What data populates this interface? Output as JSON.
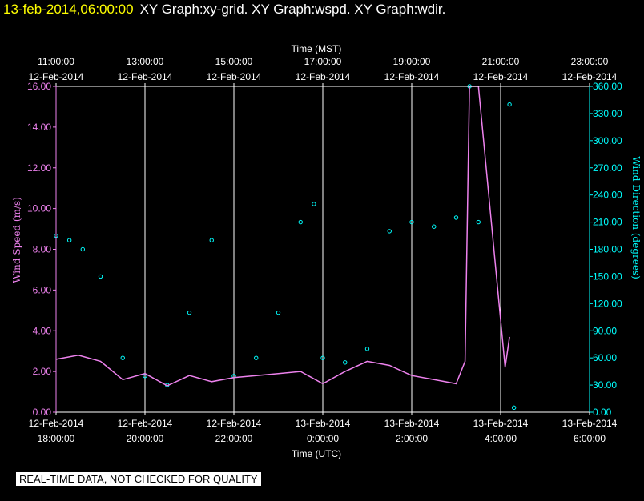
{
  "header": {
    "timestamp": "13-feb-2014,06:00:00",
    "title": "XY Graph:xy-grid.  XY Graph:wspd.  XY Graph:wdir."
  },
  "disclaimer": "REAL-TIME DATA, NOT CHECKED FOR QUALITY",
  "colors": {
    "background": "#000000",
    "axes": "#ffffff",
    "grid": "#ffffff",
    "wind_speed": "#ee82ee",
    "wind_direction": "#00ffff",
    "header_date": "#ffff00"
  },
  "chart_data": {
    "type": "scatter",
    "title": "",
    "grid": true,
    "top_axis": {
      "label": "Time (MST)",
      "ticks": [
        {
          "time": "11:00:00",
          "date": "12-Feb-2014"
        },
        {
          "time": "13:00:00",
          "date": "12-Feb-2014"
        },
        {
          "time": "15:00:00",
          "date": "12-Feb-2014"
        },
        {
          "time": "17:00:00",
          "date": "12-Feb-2014"
        },
        {
          "time": "19:00:00",
          "date": "12-Feb-2014"
        },
        {
          "time": "21:00:00",
          "date": "12-Feb-2014"
        },
        {
          "time": "23:00:00",
          "date": "12-Feb-2014"
        }
      ]
    },
    "bottom_axis": {
      "label": "Time (UTC)",
      "range_hours_utc": [
        "2014-02-12T18:00",
        "2014-02-13T06:00"
      ],
      "ticks": [
        {
          "date": "12-Feb-2014",
          "time": "18:00:00"
        },
        {
          "date": "12-Feb-2014",
          "time": "20:00:00"
        },
        {
          "date": "12-Feb-2014",
          "time": "22:00:00"
        },
        {
          "date": "13-Feb-2014",
          "time": "0:00:00"
        },
        {
          "date": "13-Feb-2014",
          "time": "2:00:00"
        },
        {
          "date": "13-Feb-2014",
          "time": "4:00:00"
        },
        {
          "date": "13-Feb-2014",
          "time": "6:00:00"
        }
      ]
    },
    "left_axis": {
      "label": "Wind Speed (m/s)",
      "ylim": [
        0,
        16
      ],
      "ticks": [
        "0.00",
        "2.00",
        "4.00",
        "6.00",
        "8.00",
        "10.00",
        "12.00",
        "14.00",
        "16.00"
      ]
    },
    "right_axis": {
      "label": "Wind Direction (degrees)",
      "ylim": [
        0,
        360
      ],
      "ticks": [
        "0.00",
        "30.00",
        "60.00",
        "90.00",
        "120.00",
        "150.00",
        "180.00",
        "210.00",
        "240.00",
        "270.00",
        "300.00",
        "330.00",
        "360.00"
      ]
    },
    "series": [
      {
        "name": "wspd",
        "style": "line",
        "axis": "left",
        "x_hours_utc": [
          18.0,
          18.5,
          19.0,
          19.5,
          20.0,
          20.5,
          21.0,
          21.5,
          22.0,
          22.5,
          23.0,
          23.5,
          24.0,
          24.5,
          25.0,
          25.5,
          26.0,
          26.5,
          27.0,
          27.2,
          27.3,
          27.5,
          28.1,
          28.2
        ],
        "values": [
          2.6,
          2.8,
          2.5,
          1.6,
          1.9,
          1.3,
          1.8,
          1.5,
          1.7,
          1.8,
          1.9,
          2.0,
          1.4,
          2.0,
          2.5,
          2.3,
          1.8,
          1.6,
          1.4,
          2.5,
          16.0,
          16.0,
          2.2,
          3.7
        ]
      },
      {
        "name": "wdir",
        "style": "markers",
        "axis": "right",
        "x_hours_utc": [
          18.0,
          18.3,
          18.6,
          19.0,
          19.5,
          20.0,
          20.5,
          21.0,
          21.5,
          22.0,
          22.5,
          23.0,
          23.5,
          23.8,
          24.0,
          24.5,
          25.0,
          25.5,
          26.0,
          26.5,
          27.0,
          27.3,
          27.5,
          28.2,
          28.3
        ],
        "values": [
          195,
          190,
          180,
          150,
          60,
          40,
          30,
          110,
          190,
          40,
          60,
          110,
          210,
          230,
          60,
          55,
          70,
          200,
          210,
          205,
          215,
          360,
          210,
          340,
          5
        ]
      }
    ]
  }
}
